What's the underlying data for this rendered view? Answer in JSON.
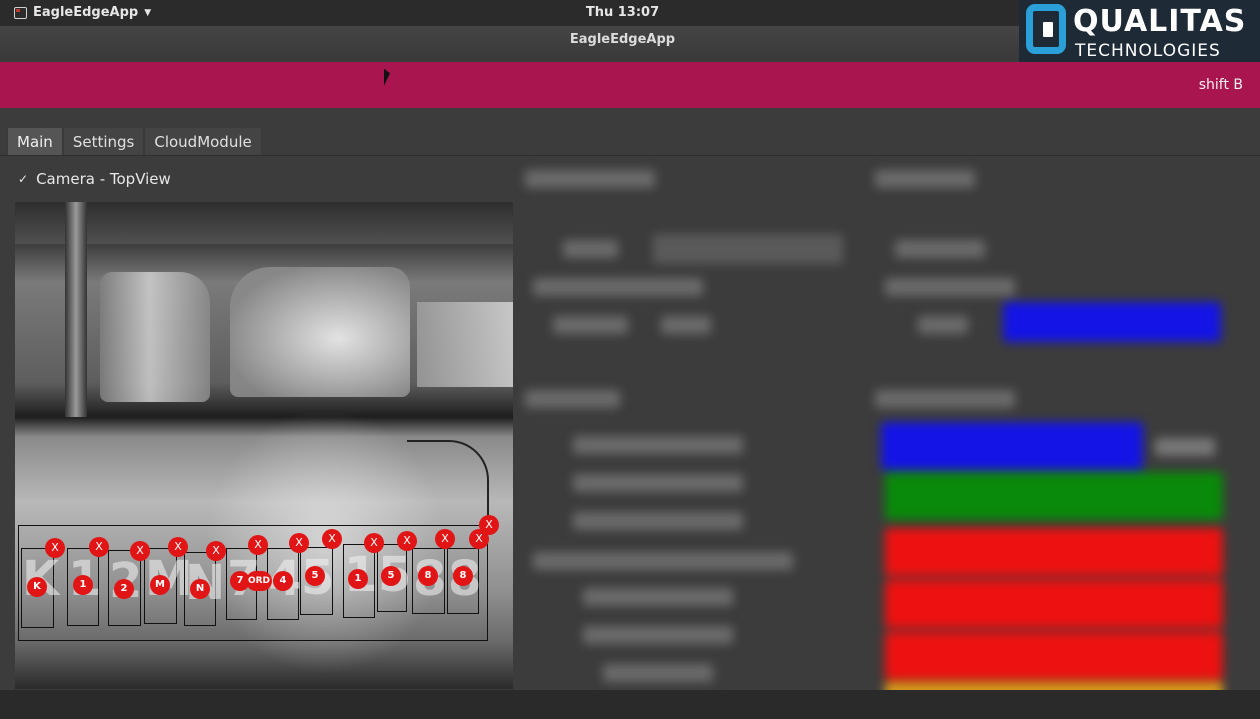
{
  "system_bar": {
    "app_menu": "EagleEdgeApp",
    "clock": "Thu 13:07"
  },
  "window": {
    "title": "EagleEdgeApp"
  },
  "logo": {
    "brand": "QUALITAS",
    "brand_sub": "TECHNOLOGIES"
  },
  "banner": {
    "shift": "shift B",
    "color": "#a8154f"
  },
  "tabs": [
    {
      "label": "Main",
      "active": true
    },
    {
      "label": "Settings",
      "active": false
    },
    {
      "label": "CloudModule",
      "active": false
    }
  ],
  "camera": {
    "header": "Camera - TopView",
    "check_glyph": "✓",
    "stamped_characters": [
      "K",
      "1",
      "2",
      "M",
      "N",
      "7",
      "4",
      "5",
      "1",
      "5",
      "8",
      "8"
    ],
    "detections": [
      {
        "label": "K",
        "reject": "X"
      },
      {
        "label": "1",
        "reject": "X"
      },
      {
        "label": "2",
        "reject": "X"
      },
      {
        "label": "M",
        "reject": "X"
      },
      {
        "label": "N",
        "reject": "X"
      },
      {
        "label": "7",
        "reject": "X"
      },
      {
        "label": "ORD",
        "reject": "X"
      },
      {
        "label": "4",
        "reject": "X"
      },
      {
        "label": "5",
        "reject": "X"
      },
      {
        "label": "1",
        "reject": "X"
      },
      {
        "label": "5",
        "reject": "X"
      },
      {
        "label": "8",
        "reject": "X"
      },
      {
        "label": "8",
        "reject": "X"
      }
    ],
    "extra_reject": "X"
  },
  "status_colors": {
    "blue": "#1414e6",
    "green": "#0a8a0a",
    "red": "#ee1111",
    "amber": "#d99a1a"
  }
}
